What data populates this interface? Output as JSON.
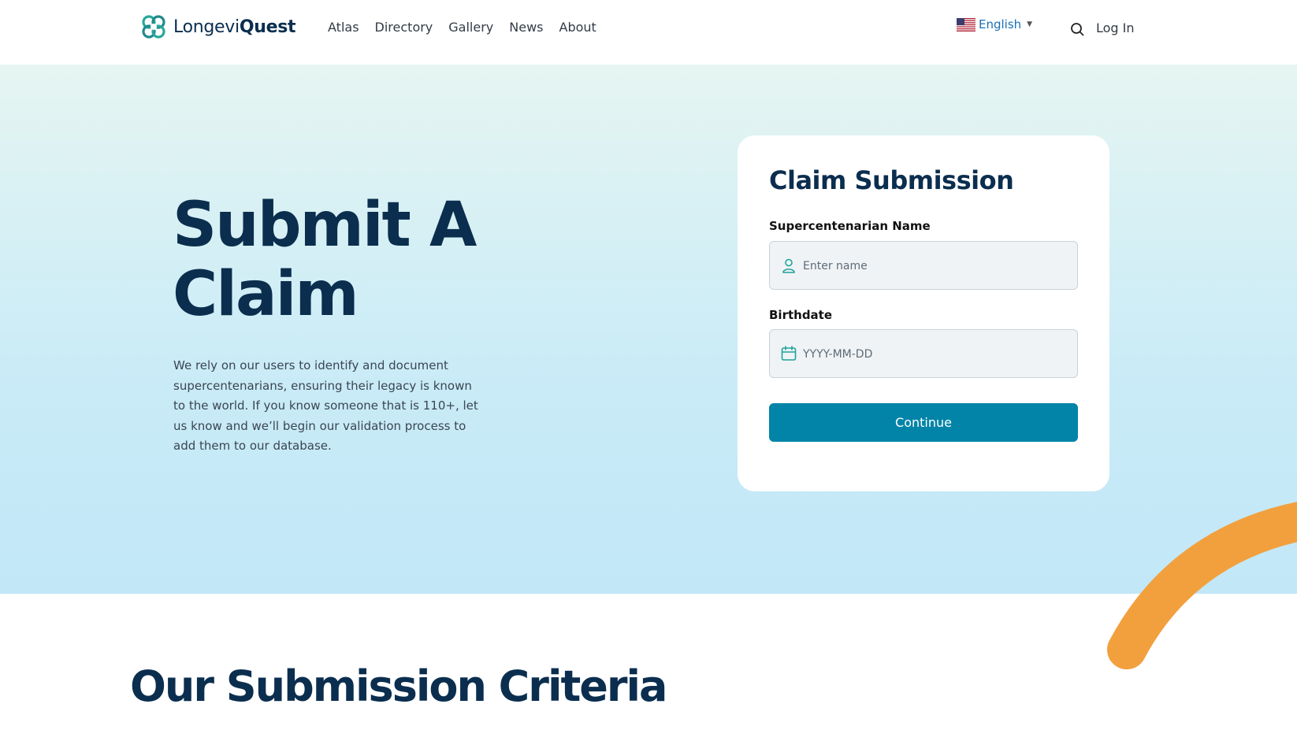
{
  "header": {
    "logo": {
      "prefix": "Longevi",
      "suffix": "Quest"
    },
    "nav": [
      "Atlas",
      "Directory",
      "Gallery",
      "News",
      "About"
    ],
    "language": {
      "label": "English",
      "flag_icon": "us-flag-icon",
      "caret_icon": "caret-down-icon"
    },
    "search_icon": "search-icon",
    "login_label": "Log In"
  },
  "hero": {
    "title_line1": "Submit A",
    "title_line2": "Claim",
    "description": "We rely on our users to identify and document supercentenarians, ensuring their legacy is known to the world. If you know someone that is 110+, let us know and we’ll begin our validation process to add them to our database."
  },
  "form": {
    "title": "Claim Submission",
    "name_label": "Supercentenarian Name",
    "name_placeholder": "Enter name",
    "name_value": "",
    "name_icon": "user-icon",
    "birthdate_label": "Birthdate",
    "birthdate_placeholder": "YYYY-MM-DD",
    "birthdate_value": "",
    "birthdate_icon": "calendar-icon",
    "continue_label": "Continue"
  },
  "criteria": {
    "title": "Our Submission Criteria"
  },
  "colors": {
    "navy": "#0b2e4f",
    "accent_blue": "#0284a8",
    "link_blue": "#1a6fb5",
    "arc_orange": "#f2a03d",
    "logo_teal": "#2aa79b"
  }
}
